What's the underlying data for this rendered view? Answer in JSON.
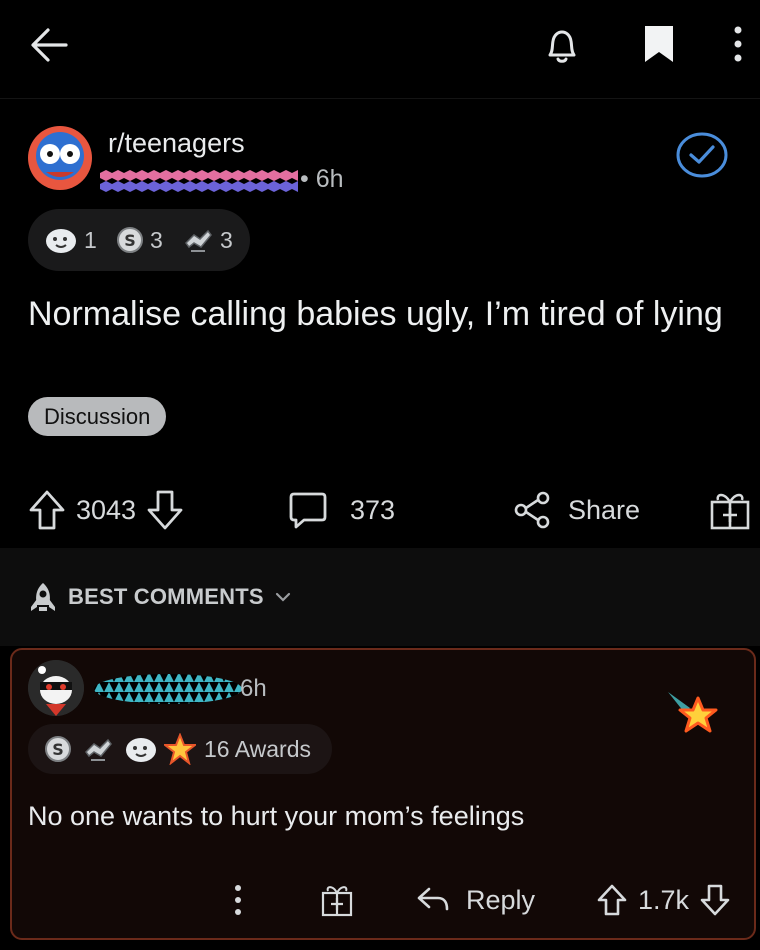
{
  "colors": {
    "background": "#000000",
    "accent_blue": "#4a8ddb",
    "flair_bg": "#b8babc",
    "highlight_border": "#6b2a1a"
  },
  "topbar": {
    "back_icon": "arrow-left-icon",
    "notifications_icon": "bell-icon",
    "save_icon": "bookmark-icon",
    "more_icon": "kebab-icon"
  },
  "post": {
    "subreddit": "r/teenagers",
    "time": "• 6h",
    "awards": [
      {
        "icon": "wholesome-award-icon",
        "count": "1"
      },
      {
        "icon": "silver-award-icon",
        "count": "3"
      },
      {
        "icon": "helpful-award-icon",
        "count": "3"
      }
    ],
    "title": "Normalise calling babies ugly, I’m tired of lying",
    "flair": "Discussion",
    "score": "3043",
    "comments": "373",
    "share_label": "Share"
  },
  "comments_section": {
    "sort_label": "BEST COMMENTS"
  },
  "comment": {
    "time": "6h",
    "awards_label": "16 Awards",
    "award_icons": [
      "silver-award-icon",
      "helpful-award-icon",
      "wholesome-award-icon",
      "starstruck-award-icon"
    ],
    "body": "No one wants to hurt your mom’s feelings",
    "reply_label": "Reply",
    "score": "1.7k"
  }
}
